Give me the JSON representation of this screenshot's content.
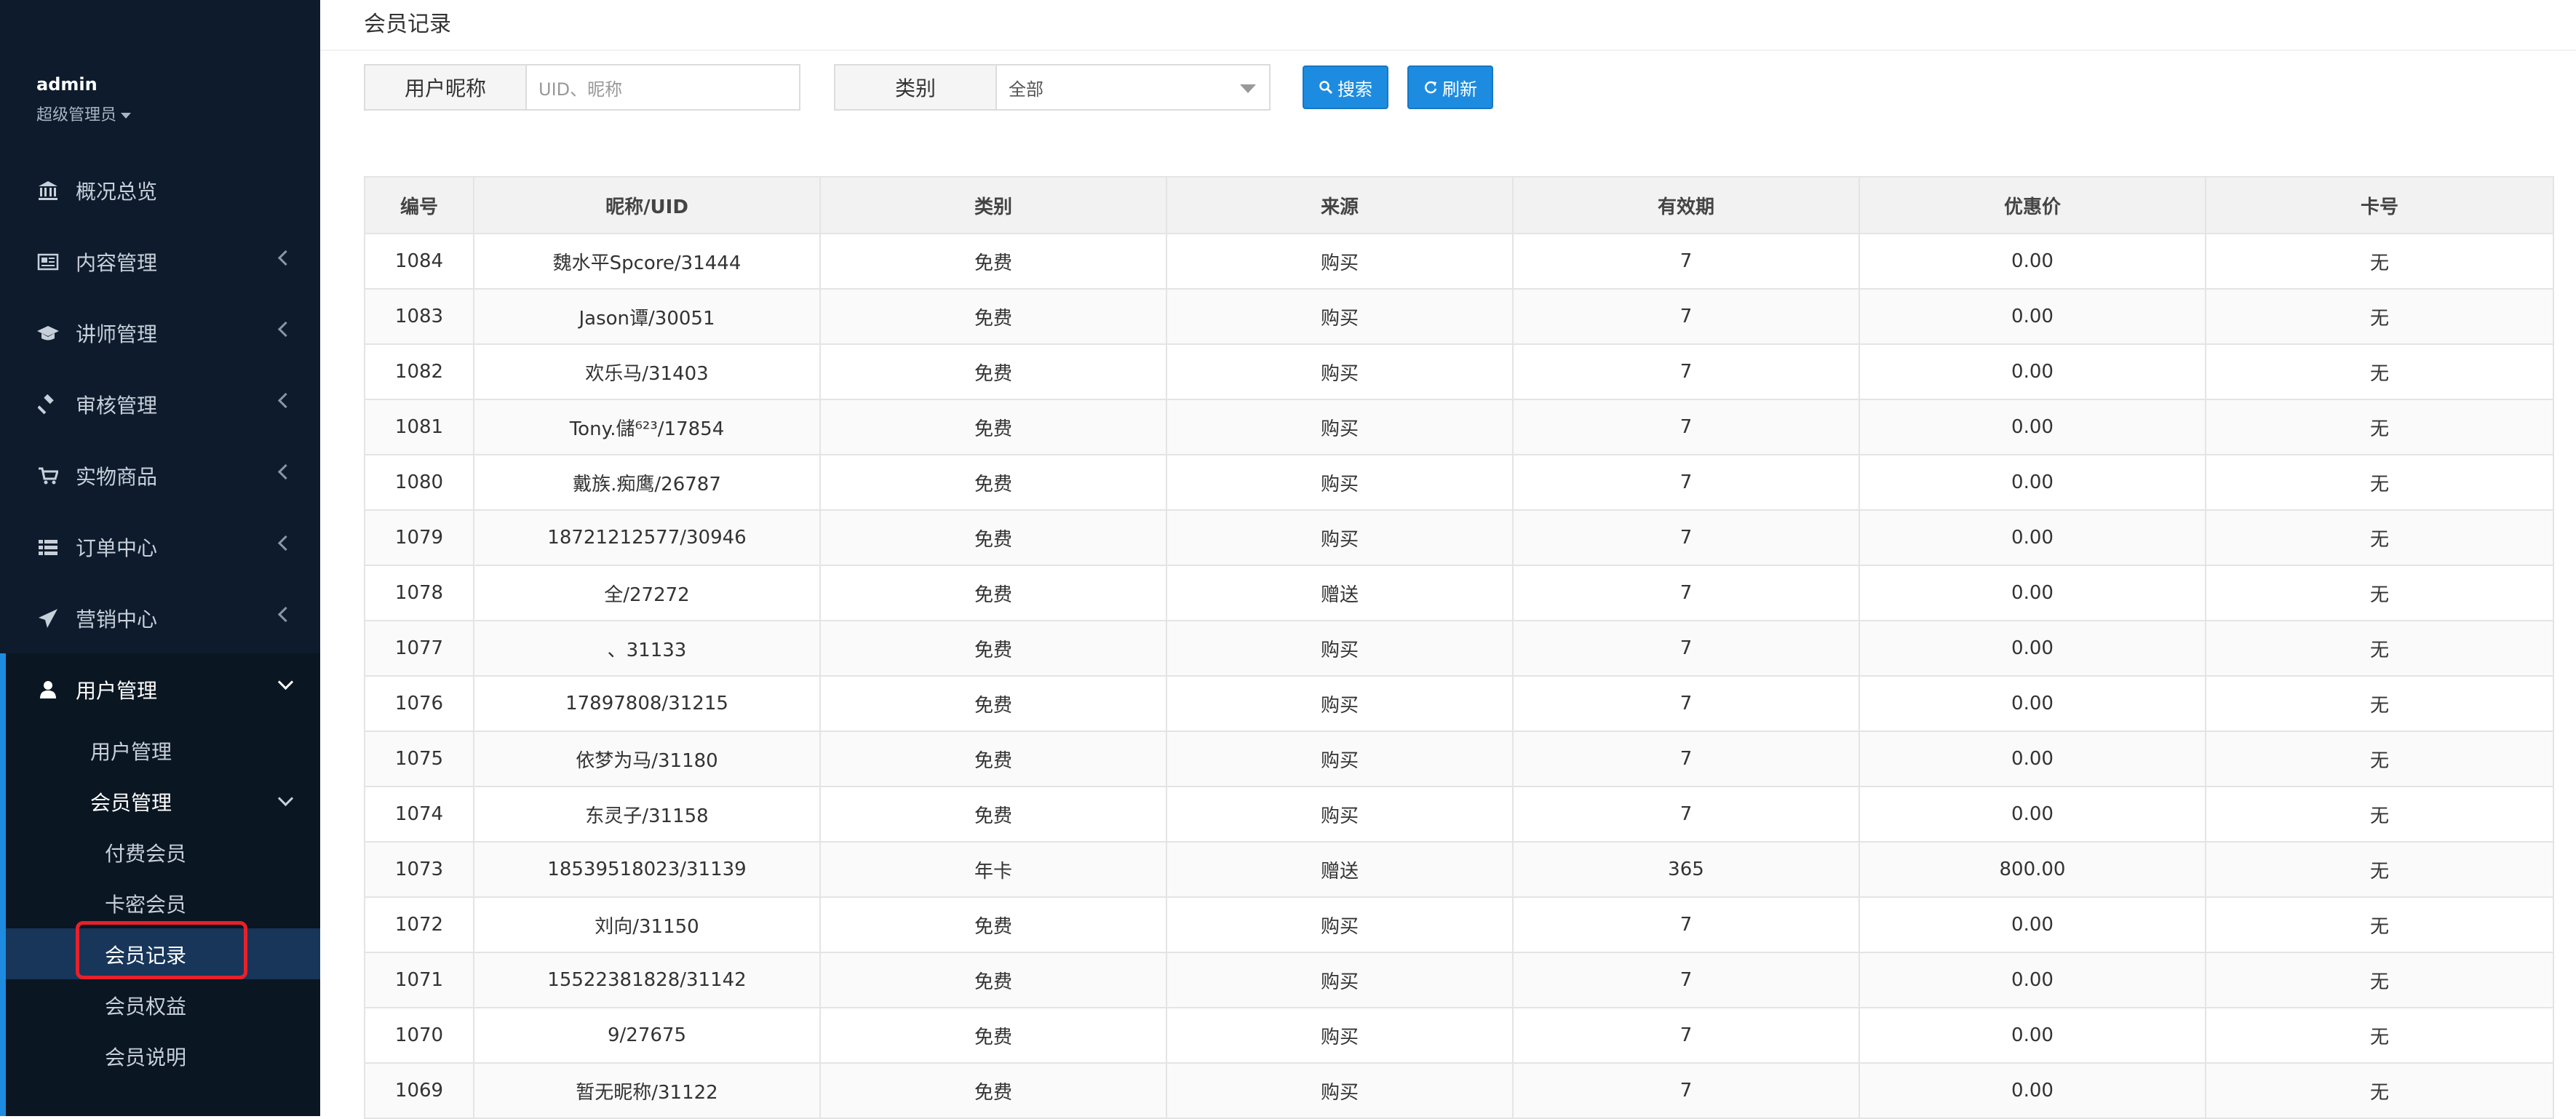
{
  "sidebar": {
    "user_name": "admin",
    "user_role": "超级管理员",
    "menu": [
      {
        "label": "概况总览",
        "icon": "bank-icon"
      },
      {
        "label": "内容管理",
        "icon": "newspaper-icon"
      },
      {
        "label": "讲师管理",
        "icon": "graduation-cap-icon"
      },
      {
        "label": "审核管理",
        "icon": "gavel-icon"
      },
      {
        "label": "实物商品",
        "icon": "cart-icon"
      },
      {
        "label": "订单中心",
        "icon": "list-icon"
      },
      {
        "label": "营销中心",
        "icon": "paper-plane-icon"
      },
      {
        "label": "用户管理",
        "icon": "user-icon"
      }
    ],
    "sub_user_manage": "用户管理",
    "sub_member_manage": "会员管理",
    "sub_paid_member": "付费会员",
    "sub_card_member": "卡密会员",
    "sub_member_record": "会员记录",
    "sub_member_rights": "会员权益",
    "sub_member_desc": "会员说明"
  },
  "page": {
    "title": "会员记录"
  },
  "filters": {
    "nickname_label": "用户昵称",
    "nickname_placeholder": "UID、昵称",
    "category_label": "类别",
    "category_value": "全部",
    "search_label": "搜索",
    "refresh_label": "刷新"
  },
  "table": {
    "headers": [
      "编号",
      "昵称/UID",
      "类别",
      "来源",
      "有效期",
      "优惠价",
      "卡号"
    ],
    "rows": [
      [
        "1084",
        "魏水平Spcore/31444",
        "免费",
        "购买",
        "7",
        "0.00",
        "无"
      ],
      [
        "1083",
        "Jason谭/30051",
        "免费",
        "购买",
        "7",
        "0.00",
        "无"
      ],
      [
        "1082",
        "欢乐马/31403",
        "免费",
        "购买",
        "7",
        "0.00",
        "无"
      ],
      [
        "1081",
        "Tony.儲⁶²³/17854",
        "免费",
        "购买",
        "7",
        "0.00",
        "无"
      ],
      [
        "1080",
        "戴族.痴鹰/26787",
        "免费",
        "购买",
        "7",
        "0.00",
        "无"
      ],
      [
        "1079",
        "18721212577/30946",
        "免费",
        "购买",
        "7",
        "0.00",
        "无"
      ],
      [
        "1078",
        "全/27272",
        "免费",
        "赠送",
        "7",
        "0.00",
        "无"
      ],
      [
        "1077",
        "、31133",
        "免费",
        "购买",
        "7",
        "0.00",
        "无"
      ],
      [
        "1076",
        "17897808/31215",
        "免费",
        "购买",
        "7",
        "0.00",
        "无"
      ],
      [
        "1075",
        "依梦为马/31180",
        "免费",
        "购买",
        "7",
        "0.00",
        "无"
      ],
      [
        "1074",
        "东灵子/31158",
        "免费",
        "购买",
        "7",
        "0.00",
        "无"
      ],
      [
        "1073",
        "18539518023/31139",
        "年卡",
        "赠送",
        "365",
        "800.00",
        "无"
      ],
      [
        "1072",
        "刘向/31150",
        "免费",
        "购买",
        "7",
        "0.00",
        "无"
      ],
      [
        "1071",
        "15522381828/31142",
        "免费",
        "购买",
        "7",
        "0.00",
        "无"
      ],
      [
        "1070",
        "9/27675",
        "免费",
        "购买",
        "7",
        "0.00",
        "无"
      ],
      [
        "1069",
        "暂无昵称/31122",
        "免费",
        "购买",
        "7",
        "0.00",
        "无"
      ]
    ]
  },
  "colors": {
    "sidebar_bg": "#0d1b2c",
    "accent": "#1d8ce0",
    "highlight_box": "#e8202a"
  }
}
